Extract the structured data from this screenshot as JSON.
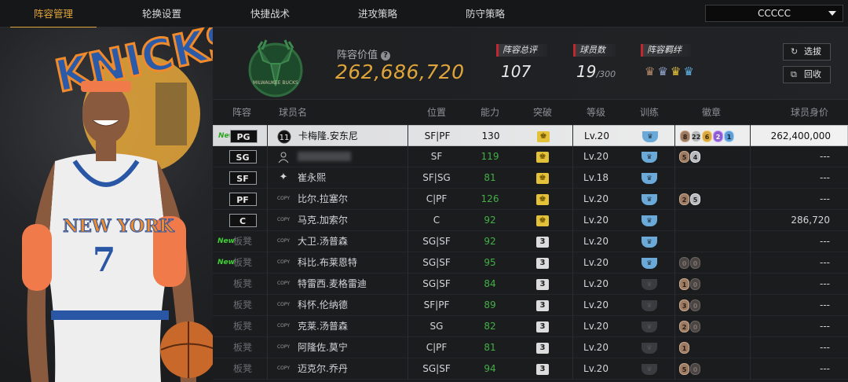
{
  "nav": {
    "tabs": [
      "阵容管理",
      "轮换设置",
      "快捷战术",
      "进攻策略",
      "防守策略"
    ],
    "active_tab": 0,
    "team_select": "CCCCC"
  },
  "summary": {
    "value_label": "阵容价值",
    "value": "262,686,720",
    "overall_label": "阵容总评",
    "overall": "107",
    "players_label": "球员数",
    "players": "19",
    "players_max": "/300",
    "bond_label": "阵容羁绊",
    "btn_select": "选拔",
    "btn_recycle": "回收"
  },
  "colors": {
    "accent": "#e0a53a",
    "stat_marker": "#c1272d",
    "new_tag": "#3fcf34"
  },
  "table": {
    "headers": [
      "阵容",
      "球员名",
      "位置",
      "能力",
      "突破",
      "等级",
      "训练",
      "徽章",
      "球员身价"
    ],
    "rows": [
      {
        "slot": "PG",
        "starter": true,
        "new": true,
        "selected": true,
        "icon": "player-11",
        "name": "卡梅隆.安东尼",
        "position": "SF|PF",
        "ability": "130",
        "ability_up": false,
        "breakthrough": "crown",
        "level": "Lv.20",
        "train": true,
        "badges": [
          [
            "b-bronze",
            "8"
          ],
          [
            "b-silver",
            "22"
          ],
          [
            "b-gold",
            "6"
          ],
          [
            "b-purple",
            "2"
          ],
          [
            "b-blue",
            "1"
          ]
        ],
        "value": "262,400,000"
      },
      {
        "slot": "SG",
        "starter": true,
        "new": false,
        "selected": false,
        "icon": "avatar",
        "name": "",
        "position": "SF",
        "ability": "119",
        "ability_up": true,
        "breakthrough": "crown",
        "level": "Lv.20",
        "train": true,
        "badges": [
          [
            "b-bronze",
            "5"
          ],
          [
            "b-silver",
            "4"
          ]
        ],
        "value": "---"
      },
      {
        "slot": "SF",
        "starter": true,
        "new": false,
        "selected": false,
        "icon": "star",
        "name": "崔永熙",
        "position": "SF|SG",
        "ability": "81",
        "ability_up": true,
        "breakthrough": "crown",
        "level": "Lv.18",
        "train": true,
        "badges": [],
        "value": "---"
      },
      {
        "slot": "PF",
        "starter": true,
        "new": false,
        "selected": false,
        "icon": "COPY",
        "name": "比尔.拉塞尔",
        "position": "C|PF",
        "ability": "126",
        "ability_up": true,
        "breakthrough": "crown",
        "level": "Lv.20",
        "train": true,
        "badges": [
          [
            "b-bronze",
            "2"
          ],
          [
            "b-silver",
            "5"
          ]
        ],
        "value": "---"
      },
      {
        "slot": "C",
        "starter": true,
        "new": false,
        "selected": false,
        "icon": "COPY",
        "name": "马克.加索尔",
        "position": "C",
        "ability": "92",
        "ability_up": true,
        "breakthrough": "crown",
        "level": "Lv.20",
        "train": true,
        "badges": [],
        "value": "286,720"
      },
      {
        "slot": "板凳",
        "starter": false,
        "new": true,
        "selected": false,
        "icon": "COPY",
        "name": "大卫.汤普森",
        "position": "SG|SF",
        "ability": "92",
        "ability_up": true,
        "breakthrough": "3",
        "level": "Lv.20",
        "train": true,
        "badges": [],
        "value": "---"
      },
      {
        "slot": "板凳",
        "starter": false,
        "new": true,
        "selected": false,
        "icon": "COPY",
        "name": "科比.布莱恩特",
        "position": "SG|SF",
        "ability": "95",
        "ability_up": true,
        "breakthrough": "3",
        "level": "Lv.20",
        "train": true,
        "badges": [
          [
            "b-empty",
            "0"
          ],
          [
            "b-empty",
            "0"
          ]
        ],
        "value": "---"
      },
      {
        "slot": "板凳",
        "starter": false,
        "new": false,
        "selected": false,
        "icon": "COPY",
        "name": "特雷西.麦格雷迪",
        "position": "SG|SF",
        "ability": "84",
        "ability_up": true,
        "breakthrough": "3",
        "level": "Lv.20",
        "train": false,
        "badges": [
          [
            "b-bronze",
            "1"
          ],
          [
            "b-empty",
            "0"
          ]
        ],
        "value": "---"
      },
      {
        "slot": "板凳",
        "starter": false,
        "new": false,
        "selected": false,
        "icon": "COPY",
        "name": "科怀.伦纳德",
        "position": "SF|PF",
        "ability": "89",
        "ability_up": true,
        "breakthrough": "3",
        "level": "Lv.20",
        "train": false,
        "badges": [
          [
            "b-bronze",
            "3"
          ],
          [
            "b-empty",
            "0"
          ]
        ],
        "value": "---"
      },
      {
        "slot": "板凳",
        "starter": false,
        "new": false,
        "selected": false,
        "icon": "COPY",
        "name": "克莱.汤普森",
        "position": "SG",
        "ability": "82",
        "ability_up": true,
        "breakthrough": "3",
        "level": "Lv.20",
        "train": false,
        "badges": [
          [
            "b-bronze",
            "2"
          ],
          [
            "b-empty",
            "0"
          ]
        ],
        "value": "---"
      },
      {
        "slot": "板凳",
        "starter": false,
        "new": false,
        "selected": false,
        "icon": "COPY",
        "name": "阿隆佐.莫宁",
        "position": "C|PF",
        "ability": "81",
        "ability_up": true,
        "breakthrough": "3",
        "level": "Lv.20",
        "train": false,
        "badges": [
          [
            "b-bronze",
            "1"
          ]
        ],
        "value": "---"
      },
      {
        "slot": "板凳",
        "starter": false,
        "new": false,
        "selected": false,
        "icon": "COPY",
        "name": "迈克尔.乔丹",
        "position": "SG|SF",
        "ability": "94",
        "ability_up": true,
        "breakthrough": "3",
        "level": "Lv.20",
        "train": false,
        "badges": [
          [
            "b-bronze",
            "5"
          ],
          [
            "b-empty",
            "0"
          ]
        ],
        "value": "---"
      }
    ]
  },
  "art": {
    "jersey_text": "NEW YORK",
    "jersey_number": "7",
    "banner_text": "KNICKS",
    "logo_text": "MILWAUKEE BUCKS"
  }
}
